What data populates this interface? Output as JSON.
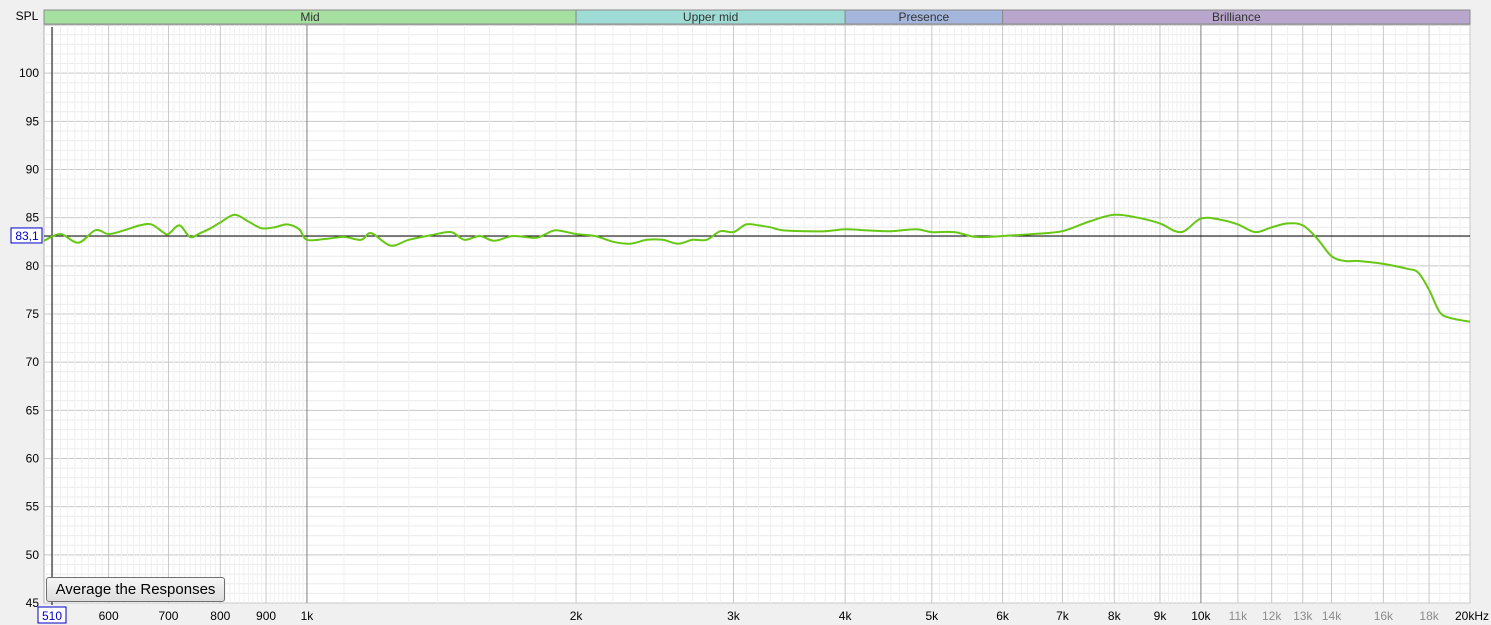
{
  "chart_data": {
    "type": "line",
    "title": "",
    "ylabel": "SPL",
    "xlabel": "",
    "x_scale": "log",
    "xlim": [
      508,
      20000
    ],
    "ylim": [
      45,
      105
    ],
    "grid": true,
    "y_ticks": [
      45,
      50,
      55,
      60,
      65,
      70,
      75,
      80,
      85,
      90,
      95,
      100
    ],
    "y_tick_labels": [
      "45",
      "50",
      "55",
      "60",
      "65",
      "70",
      "75",
      "80",
      "85",
      "90",
      "95",
      "100"
    ],
    "x_ticks": [
      {
        "v": 510,
        "label": "510",
        "boxed": true,
        "muted": false
      },
      {
        "v": 600,
        "label": "600",
        "muted": false
      },
      {
        "v": 700,
        "label": "700",
        "muted": false
      },
      {
        "v": 800,
        "label": "800",
        "muted": false
      },
      {
        "v": 900,
        "label": "900",
        "muted": false
      },
      {
        "v": 1000,
        "label": "1k",
        "muted": false
      },
      {
        "v": 2000,
        "label": "2k",
        "muted": false
      },
      {
        "v": 3000,
        "label": "3k",
        "muted": false
      },
      {
        "v": 4000,
        "label": "4k",
        "muted": false
      },
      {
        "v": 5000,
        "label": "5k",
        "muted": false
      },
      {
        "v": 6000,
        "label": "6k",
        "muted": false
      },
      {
        "v": 7000,
        "label": "7k",
        "muted": false
      },
      {
        "v": 8000,
        "label": "8k",
        "muted": false
      },
      {
        "v": 9000,
        "label": "9k",
        "muted": false
      },
      {
        "v": 10000,
        "label": "10k",
        "muted": false
      },
      {
        "v": 11000,
        "label": "11k",
        "muted": true
      },
      {
        "v": 12000,
        "label": "12k",
        "muted": true
      },
      {
        "v": 13000,
        "label": "13k",
        "muted": true
      },
      {
        "v": 14000,
        "label": "14k",
        "muted": true
      },
      {
        "v": 16000,
        "label": "16k",
        "muted": true
      },
      {
        "v": 18000,
        "label": "18k",
        "muted": true
      },
      {
        "v": 20000,
        "label": "20kHz",
        "muted": false
      }
    ],
    "bands": [
      {
        "name": "Mid",
        "from": 508,
        "to": 2000,
        "color": "#a6e0a0"
      },
      {
        "name": "Upper mid",
        "from": 2000,
        "to": 4000,
        "color": "#a0dcd6"
      },
      {
        "name": "Presence",
        "from": 4000,
        "to": 6000,
        "color": "#a4b6dc"
      },
      {
        "name": "Brilliance",
        "from": 6000,
        "to": 20000,
        "color": "#b8a6cc"
      }
    ],
    "reference_line": {
      "value": 83.1,
      "label": "83,1"
    },
    "series": [
      {
        "color": "#66c814",
        "points": [
          [
            508,
            82.6
          ],
          [
            530,
            83.3
          ],
          [
            555,
            82.4
          ],
          [
            580,
            83.7
          ],
          [
            600,
            83.3
          ],
          [
            625,
            83.7
          ],
          [
            650,
            84.2
          ],
          [
            670,
            84.3
          ],
          [
            690,
            83.5
          ],
          [
            700,
            83.3
          ],
          [
            720,
            84.2
          ],
          [
            740,
            83.0
          ],
          [
            760,
            83.4
          ],
          [
            780,
            83.9
          ],
          [
            800,
            84.5
          ],
          [
            830,
            85.3
          ],
          [
            860,
            84.6
          ],
          [
            890,
            83.9
          ],
          [
            920,
            84.0
          ],
          [
            950,
            84.3
          ],
          [
            980,
            83.8
          ],
          [
            1000,
            82.7
          ],
          [
            1050,
            82.8
          ],
          [
            1100,
            83.0
          ],
          [
            1150,
            82.7
          ],
          [
            1180,
            83.4
          ],
          [
            1240,
            82.1
          ],
          [
            1300,
            82.7
          ],
          [
            1380,
            83.2
          ],
          [
            1450,
            83.5
          ],
          [
            1500,
            82.7
          ],
          [
            1560,
            83.1
          ],
          [
            1620,
            82.6
          ],
          [
            1700,
            83.1
          ],
          [
            1800,
            82.9
          ],
          [
            1850,
            83.3
          ],
          [
            1900,
            83.7
          ],
          [
            2000,
            83.3
          ],
          [
            2100,
            83.1
          ],
          [
            2200,
            82.5
          ],
          [
            2300,
            82.3
          ],
          [
            2400,
            82.7
          ],
          [
            2500,
            82.7
          ],
          [
            2600,
            82.3
          ],
          [
            2700,
            82.7
          ],
          [
            2800,
            82.7
          ],
          [
            2900,
            83.6
          ],
          [
            3000,
            83.5
          ],
          [
            3100,
            84.3
          ],
          [
            3200,
            84.2
          ],
          [
            3300,
            84.0
          ],
          [
            3400,
            83.7
          ],
          [
            3600,
            83.6
          ],
          [
            3800,
            83.6
          ],
          [
            4000,
            83.8
          ],
          [
            4200,
            83.7
          ],
          [
            4500,
            83.6
          ],
          [
            4800,
            83.8
          ],
          [
            5000,
            83.5
          ],
          [
            5300,
            83.5
          ],
          [
            5600,
            83.0
          ],
          [
            6000,
            83.1
          ],
          [
            6500,
            83.3
          ],
          [
            7000,
            83.6
          ],
          [
            7500,
            84.6
          ],
          [
            8000,
            85.3
          ],
          [
            8500,
            85.0
          ],
          [
            9000,
            84.4
          ],
          [
            9500,
            83.5
          ],
          [
            10000,
            84.9
          ],
          [
            10500,
            84.8
          ],
          [
            11000,
            84.3
          ],
          [
            11500,
            83.5
          ],
          [
            12000,
            84.0
          ],
          [
            12500,
            84.4
          ],
          [
            13000,
            84.2
          ],
          [
            13500,
            82.8
          ],
          [
            14000,
            81.0
          ],
          [
            14500,
            80.5
          ],
          [
            15000,
            80.5
          ],
          [
            16000,
            80.2
          ],
          [
            17000,
            79.7
          ],
          [
            17500,
            79.3
          ],
          [
            18000,
            77.5
          ],
          [
            18500,
            75.2
          ],
          [
            19000,
            74.6
          ],
          [
            20000,
            74.2
          ]
        ]
      }
    ]
  },
  "controls": {
    "average_button_label": "Average the Responses"
  }
}
